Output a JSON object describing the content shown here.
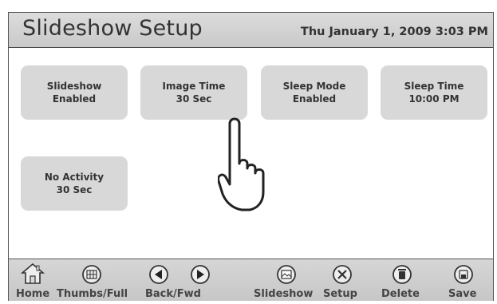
{
  "header": {
    "title": "Slideshow Setup",
    "datetime": "Thu January 1, 2009  3:03 PM"
  },
  "tiles": [
    {
      "line1": "Slideshow",
      "line2": "Enabled"
    },
    {
      "line1": "Image Time",
      "line2": "30 Sec"
    },
    {
      "line1": "Sleep Mode",
      "line2": "Enabled"
    },
    {
      "line1": "Sleep Time",
      "line2": "10:00 PM"
    },
    {
      "line1": "No Activity",
      "line2": "30 Sec"
    }
  ],
  "toolbar": {
    "home": "Home",
    "thumbs": "Thumbs/Full",
    "backfwd": "Back/Fwd",
    "slideshow": "Slideshow",
    "setup": "Setup",
    "delete": "Delete",
    "save": "Save"
  },
  "icons": {
    "home": "home-icon",
    "thumbs": "grid-icon",
    "back": "back-arrow-icon",
    "forward": "forward-arrow-icon",
    "slideshow": "picture-icon",
    "setup": "tools-icon",
    "delete": "trash-icon",
    "save": "disk-icon",
    "pointer": "hand-pointer-icon"
  }
}
